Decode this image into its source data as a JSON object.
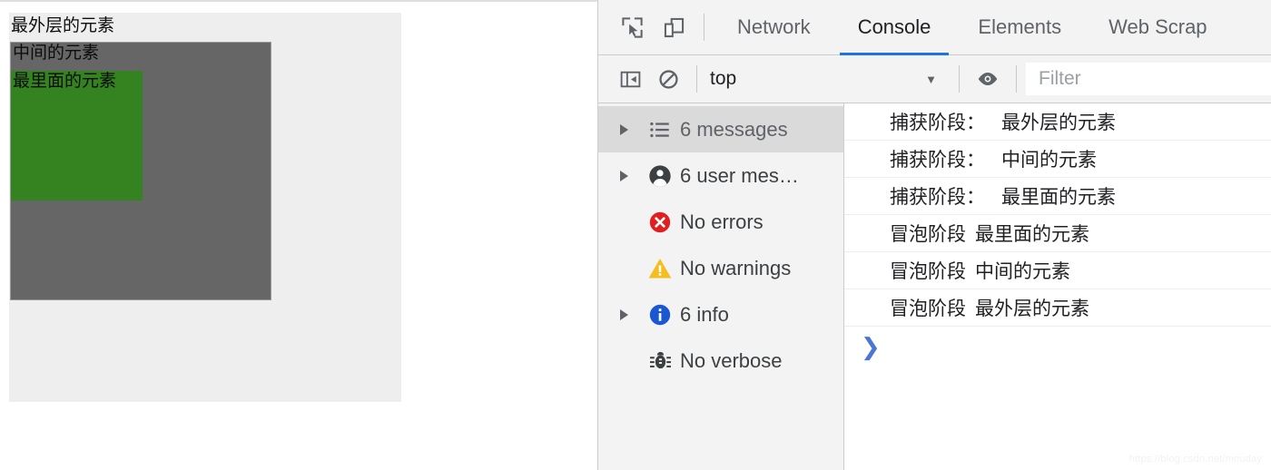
{
  "page": {
    "outer_box": {
      "label": "最外层的元素",
      "bg": "#eeeeee"
    },
    "middle_box": {
      "label": "中间的元素",
      "bg": "#666666"
    },
    "inner_box": {
      "label": "最里面的元素",
      "bg": "#348220"
    }
  },
  "devtools": {
    "toolbar": {
      "inspect_icon": "inspect-element-icon",
      "device_icon": "device-toolbar-icon"
    },
    "tabs": [
      {
        "label": "Network",
        "active": false
      },
      {
        "label": "Console",
        "active": true
      },
      {
        "label": "Elements",
        "active": false
      },
      {
        "label": "Web Scrap",
        "active": false
      }
    ],
    "active_tab_accent": "#1a73e8",
    "filterbar": {
      "sidebar_toggle_icon": "show-console-sidebar-icon",
      "clear_icon": "clear-console-icon",
      "context": "top",
      "caret": "▼",
      "eye_icon": "live-expression-eye-icon",
      "filter_placeholder": "Filter"
    },
    "sidebar": [
      {
        "label": "6 messages",
        "icon": "list-icon",
        "arrow": true,
        "selected": true
      },
      {
        "label": "6 user mes…",
        "icon": "person-icon",
        "arrow": true,
        "selected": false
      },
      {
        "label": "No errors",
        "icon": "error-icon",
        "arrow": false,
        "selected": false
      },
      {
        "label": "No warnings",
        "icon": "warning-icon",
        "arrow": false,
        "selected": false
      },
      {
        "label": "6 info",
        "icon": "info-icon",
        "arrow": true,
        "selected": false
      },
      {
        "label": "No verbose",
        "icon": "bug-icon",
        "arrow": false,
        "selected": false
      }
    ],
    "messages": [
      {
        "phase": "捕获阶段：",
        "target": "最外层的元素",
        "colon": true
      },
      {
        "phase": "捕获阶段：",
        "target": "中间的元素",
        "colon": true
      },
      {
        "phase": "捕获阶段：",
        "target": "最里面的元素",
        "colon": true
      },
      {
        "phase": "冒泡阶段",
        "target": "最里面的元素",
        "colon": false
      },
      {
        "phase": "冒泡阶段",
        "target": "中间的元素",
        "colon": false
      },
      {
        "phase": "冒泡阶段",
        "target": "最外层的元素",
        "colon": false
      }
    ],
    "prompt_chevron": "❯"
  },
  "watermark": "https://blog.csdn.net/mouday"
}
